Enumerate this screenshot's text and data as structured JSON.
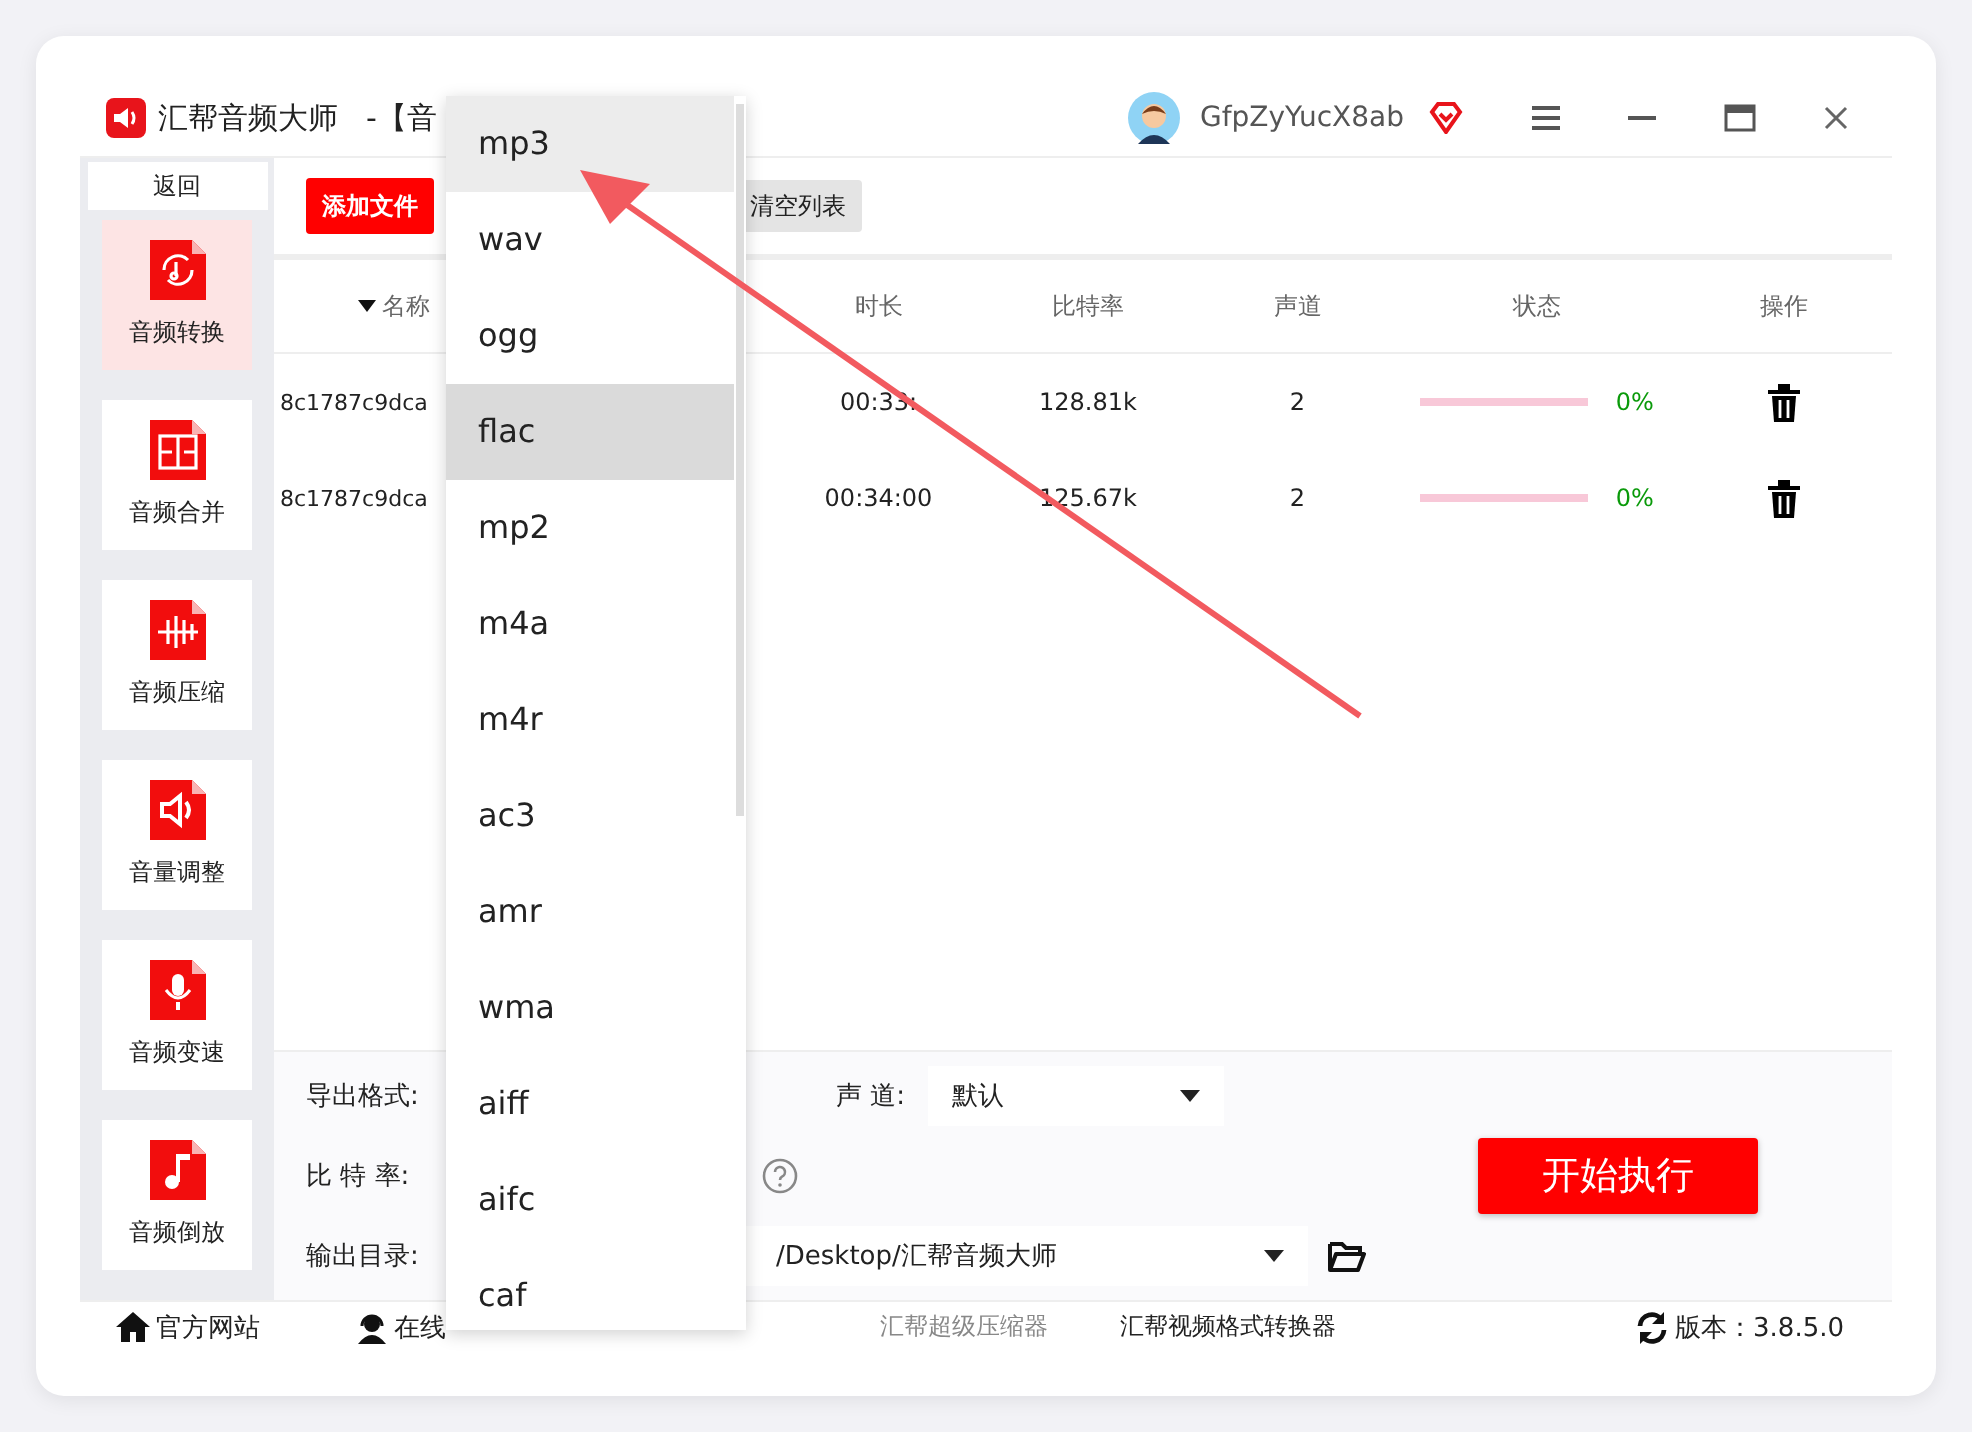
{
  "window": {
    "title": "汇帮音频大师",
    "subtitle": "-【音",
    "user": "GfpZyYucX8ab"
  },
  "sidebar": {
    "back": "返回",
    "items": [
      {
        "label": "音频转换",
        "kind": "convert",
        "selected": true
      },
      {
        "label": "音频合并",
        "kind": "merge",
        "selected": false
      },
      {
        "label": "音频压缩",
        "kind": "compress",
        "selected": false
      },
      {
        "label": "音量调整",
        "kind": "volume",
        "selected": false
      },
      {
        "label": "音频变速",
        "kind": "speed",
        "selected": false
      },
      {
        "label": "音频倒放",
        "kind": "reverse",
        "selected": false
      }
    ]
  },
  "toolbar": {
    "add_button": "添加文件",
    "clear_button": "清空列表"
  },
  "table": {
    "columns": [
      {
        "label": "名称",
        "sorted": true
      },
      {
        "label": "时长",
        "sorted": false
      },
      {
        "label": "比特率",
        "sorted": false
      },
      {
        "label": "声道",
        "sorted": false
      },
      {
        "label": "状态",
        "sorted": false
      },
      {
        "label": "操作",
        "sorted": false
      }
    ],
    "rows": [
      {
        "name": "8c1787c9dca",
        "duration": "00:33:",
        "bitrate": "128.81k",
        "channels": "2",
        "level": 0,
        "progress": "0%"
      },
      {
        "name": "8c1787c9dca",
        "duration": "00:34:00",
        "bitrate": "125.67k",
        "channels": "2",
        "level": 0,
        "progress": "0%"
      }
    ]
  },
  "settings": {
    "format_label": "导出格式:",
    "channel_label": "声 道:",
    "channel_value": "默认",
    "bitrate_label": "比 特 率:",
    "output_label": "输出目录:",
    "output_path": "/Desktop/汇帮音频大师",
    "start_button": "开始执行"
  },
  "status_bar": {
    "links": [
      {
        "label": "官方网站",
        "kind": "home"
      },
      {
        "label": "在线",
        "kind": "support"
      },
      {
        "label": "汇帮超级压缩器",
        "kind": "muted"
      },
      {
        "label": "汇帮视频格式转换器",
        "kind": "plain"
      }
    ],
    "version": "版本：3.8.5.0"
  },
  "dropdown": {
    "items": [
      {
        "label": "mp3",
        "hovered": true,
        "selected": false
      },
      {
        "label": "wav",
        "hovered": false,
        "selected": false
      },
      {
        "label": "ogg",
        "hovered": false,
        "selected": false
      },
      {
        "label": "flac",
        "hovered": false,
        "selected": true
      },
      {
        "label": "mp2",
        "hovered": false,
        "selected": false
      },
      {
        "label": "m4a",
        "hovered": false,
        "selected": false
      },
      {
        "label": "m4r",
        "hovered": false,
        "selected": false
      },
      {
        "label": "ac3",
        "hovered": false,
        "selected": false
      },
      {
        "label": "amr",
        "hovered": false,
        "selected": false
      },
      {
        "label": "wma",
        "hovered": false,
        "selected": false
      },
      {
        "label": "aiff",
        "hovered": false,
        "selected": false
      },
      {
        "label": "aifc",
        "hovered": false,
        "selected": false
      },
      {
        "label": "caf",
        "hovered": false,
        "selected": false
      }
    ]
  }
}
